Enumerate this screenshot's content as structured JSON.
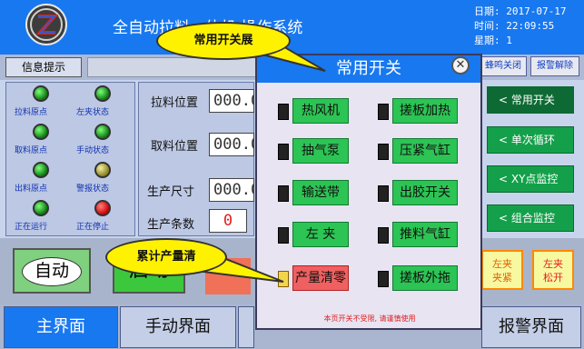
{
  "header": {
    "title": "全自动拉料一体机 操作系统",
    "date": "日期: 2017-07-17",
    "time": "时间: 22:09:55",
    "weekday": "星期: 1"
  },
  "info_bar": {
    "label": "信息提示",
    "buzzer_off": "蜂鸣关闭",
    "alarm_clear": "报警解除"
  },
  "status_panel": {
    "items": [
      {
        "label": "拉料原点",
        "state": "green"
      },
      {
        "label": "左夹状态",
        "state": "green"
      },
      {
        "label": "取料原点",
        "state": "green"
      },
      {
        "label": "手动状态",
        "state": "green"
      },
      {
        "label": "出料原点",
        "state": "green"
      },
      {
        "label": "警报状态",
        "state": "yellow"
      },
      {
        "label": "正在运行",
        "state": "green"
      },
      {
        "label": "正在停止",
        "state": "red"
      }
    ]
  },
  "values_panel": {
    "pull_pos_label": "拉料位置",
    "pull_pos_value": "000.0",
    "take_pos_label": "取料位置",
    "take_pos_value": "000.0",
    "size_label": "生产尺寸",
    "size_value": "000.0",
    "count_label": "生产条数",
    "count_value": "0"
  },
  "nav": {
    "common_switch": "< 常用开关",
    "single_cycle": "< 单次循环",
    "xy_monitor": "< XY点监控",
    "group_monitor": "< 组合监控"
  },
  "controls": {
    "auto": "自动",
    "start": "启动",
    "left_clamp_tight": "左夹\n夹紧",
    "left_clamp_loose": "左夹\n松开"
  },
  "tabs": {
    "main": "主界面",
    "manual": "手动界面",
    "alarm": "报警界面"
  },
  "popup": {
    "title": "常用开关",
    "close_icon": "close-icon",
    "note": "本页开关不受限, 请谨慎使用",
    "switches": [
      {
        "label": "热风机",
        "on": false
      },
      {
        "label": "搓板加热",
        "on": false
      },
      {
        "label": "抽气泵",
        "on": false
      },
      {
        "label": "压紧气缸",
        "on": false
      },
      {
        "label": "输送带",
        "on": false
      },
      {
        "label": "出胶开关",
        "on": false
      },
      {
        "label": "左 夹",
        "on": false
      },
      {
        "label": "推料气缸",
        "on": false
      },
      {
        "label": "产量清零",
        "on": true
      },
      {
        "label": "搓板外拖",
        "on": false
      }
    ]
  },
  "callouts": {
    "common_switch": "常用开关展",
    "reset_count": "累计产量清"
  },
  "colors": {
    "header_blue": "#1878f0",
    "nav_green": "#14a04a",
    "switch_green": "#2cc454",
    "switch_on_red": "#f06060",
    "callout_yellow": "#fff200"
  }
}
